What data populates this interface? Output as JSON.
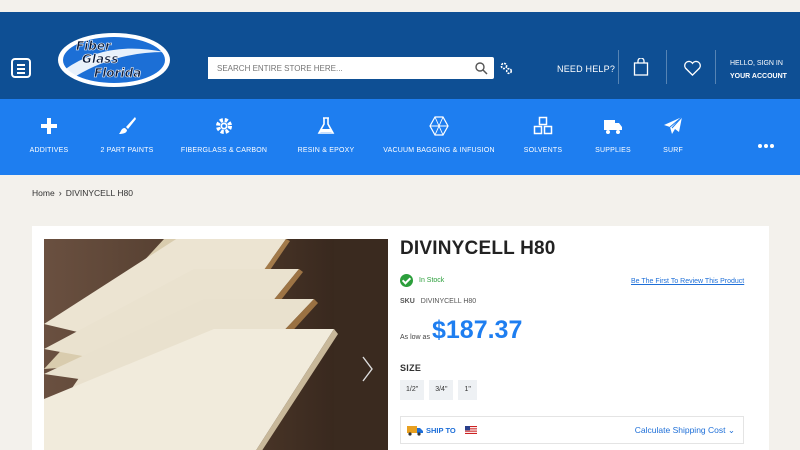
{
  "header": {
    "logo_text": [
      "Fiber",
      "Glass",
      "Florida"
    ],
    "search_placeholder": "SEARCH ENTIRE STORE HERE...",
    "need_help": "NEED HELP?",
    "account_line1": "HELLO, SIGN IN",
    "account_line2": "YOUR ACCOUNT"
  },
  "categories": [
    {
      "label": "ADDITIVES",
      "icon": "plus-icon"
    },
    {
      "label": "2 PART PAINTS",
      "icon": "brush-icon"
    },
    {
      "label": "FIBERGLASS & CARBON",
      "icon": "gear-icon"
    },
    {
      "label": "RESIN & EPOXY",
      "icon": "flask-icon"
    },
    {
      "label": "VACUUM BAGGING & INFUSION",
      "icon": "polygon-icon"
    },
    {
      "label": "SOLVENTS",
      "icon": "cubes-icon"
    },
    {
      "label": "SUPPLIES",
      "icon": "truck-icon"
    },
    {
      "label": "SURF",
      "icon": "paper-plane-icon"
    }
  ],
  "breadcrumb": {
    "home": "Home",
    "current": "DIVINYCELL H80"
  },
  "product": {
    "title": "DIVINYCELL H80",
    "stock": "In Stock",
    "review_link": "Be The First To Review This Product",
    "sku_label": "SKU",
    "sku_value": "DIVINYCELL H80",
    "as_low_as": "As low as",
    "price": "$187.37",
    "size_label": "SIZE",
    "sizes": [
      "1/2\"",
      "3/4\"",
      "1\""
    ],
    "ship_to": "SHIP TO",
    "calc_shipping": "Calculate Shipping Cost"
  },
  "colors": {
    "header_bg": "#0e4f94",
    "nav_bg": "#1e7ef0",
    "price": "#1e7ef0",
    "in_stock": "#2c9f3c"
  }
}
